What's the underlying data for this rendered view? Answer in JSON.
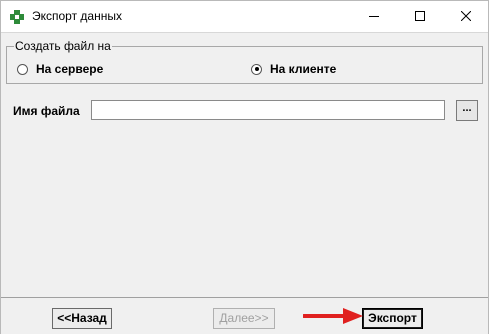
{
  "window": {
    "title": "Экспорт данных",
    "icon": "app-puzzle-icon",
    "controls": [
      "minimize-icon",
      "maximize-icon",
      "close-icon"
    ]
  },
  "create_group": {
    "title": "Создать файл на",
    "options": [
      {
        "label": "На сервере",
        "selected": false
      },
      {
        "label": "На клиенте",
        "selected": true
      }
    ]
  },
  "filename": {
    "label": "Имя файла",
    "value": "",
    "browse_label": "..."
  },
  "buttons": {
    "back": "<<Назад",
    "next": "Далее>>",
    "export": "Экспорт"
  },
  "colors": {
    "accent_arrow": "#e0201f",
    "icon_green": "#2e8b3a"
  }
}
